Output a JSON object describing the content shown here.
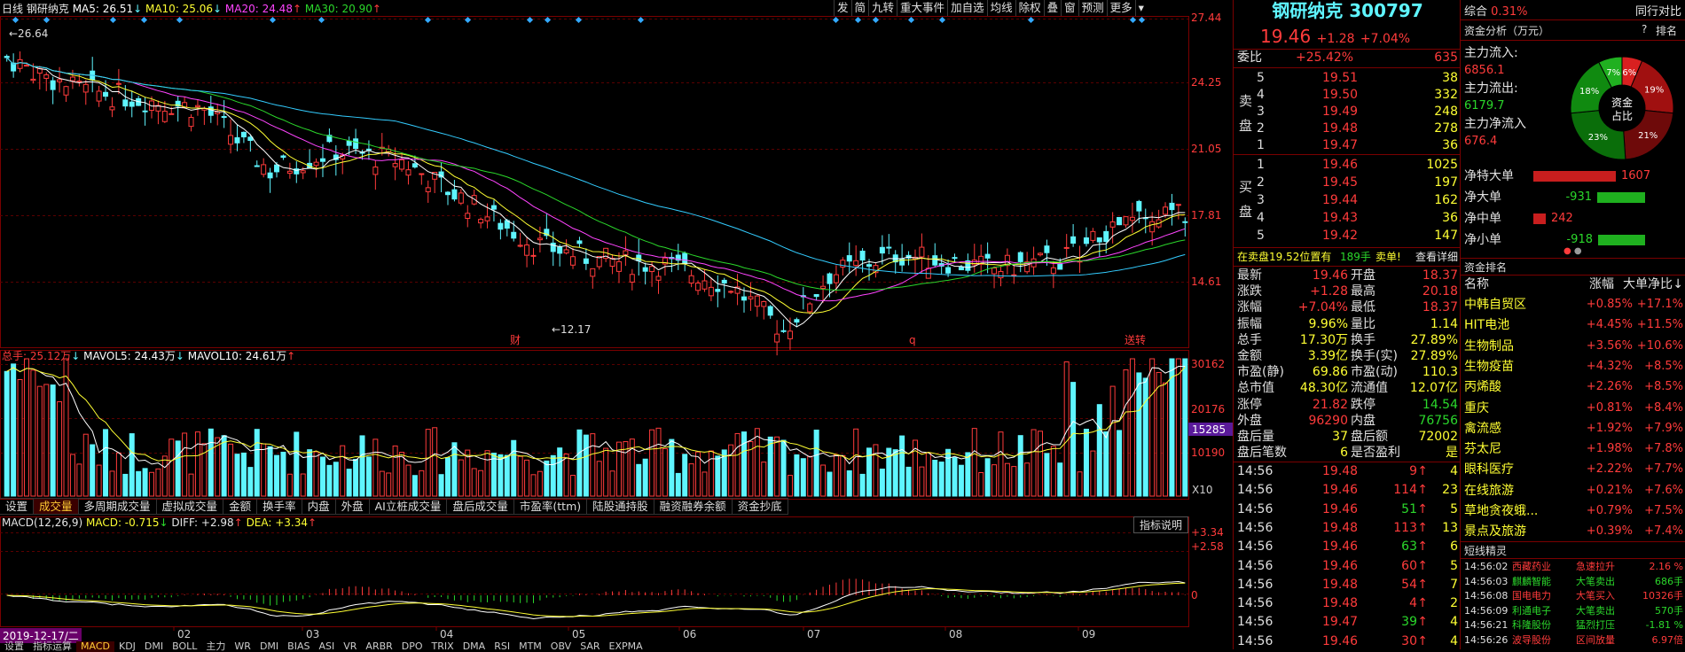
{
  "chart": {
    "period": "日线",
    "stock": "钢研纳克",
    "ma": [
      {
        "label": "MA5: 26.51",
        "color": "#ffffff",
        "dir": "down"
      },
      {
        "label": "MA10: 25.06",
        "color": "#ffff33",
        "dir": "down"
      },
      {
        "label": "MA20: 24.48",
        "color": "#ff44ff",
        "dir": "up"
      },
      {
        "label": "MA30: 20.90",
        "color": "#2bd82b",
        "dir": "up"
      }
    ],
    "toolbar": [
      "发",
      "简",
      "九转",
      "重大事件",
      "加自选",
      "均线",
      "除权",
      "叠",
      "窗",
      "预测",
      "更多"
    ],
    "price_ticks": [
      "27.44",
      "24.25",
      "21.05",
      "17.81",
      "14.61"
    ],
    "high_mark": "26.64",
    "low_mark": "12.17",
    "markers": [
      "财",
      "q",
      "送转"
    ],
    "vol_legend": [
      {
        "label": "总手: 25.12万",
        "color": "#ff3b3b",
        "dir": "down"
      },
      {
        "label": "MAVOL5: 24.43万",
        "color": "#ffffff",
        "dir": "down"
      },
      {
        "label": "MAVOL10: 24.61万",
        "color": "#ffffff",
        "dir": "up"
      }
    ],
    "vol_ticks": [
      "30162",
      "20176",
      "10190"
    ],
    "vol_flag": "15285",
    "vol_unit": "X10",
    "tabs": [
      "设置",
      "成交量",
      "多周期成交量",
      "虚拟成交量",
      "金额",
      "换手率",
      "内盘",
      "外盘",
      "AI立桩成交量",
      "盘后成交量",
      "市盈率(ttm)",
      "陆股通持股",
      "融资融券余额",
      "资金抄底"
    ],
    "tabs_active": 1,
    "macd_label": "MACD(12,26,9)",
    "macd_val": "MACD: -0.715",
    "diff_val": "DIFF: +2.98",
    "dea_val": "DEA: +3.34",
    "macd_ticks": [
      "+3.34",
      "+2.58",
      "0"
    ],
    "indicator_btn": "指标说明",
    "date_cursor": "2019-12-17/二",
    "months": [
      "02",
      "03",
      "04",
      "05",
      "06",
      "07",
      "08",
      "09"
    ],
    "bottom_tabs": [
      "设置",
      "指标运算",
      "MACD",
      "KDJ",
      "DMI",
      "BOLL",
      "主力",
      "WR",
      "DMI",
      "BIAS",
      "ASI",
      "VR",
      "ARBR",
      "DPO",
      "TRIX",
      "DMA",
      "RSI",
      "MTM",
      "OBV",
      "SAR",
      "EXPMA"
    ],
    "bottom_active": 2
  },
  "quote": {
    "name": "钢研纳克",
    "code": "300797",
    "price": "19.46",
    "change": "+1.28",
    "pct": "+7.04%",
    "weibi_label": "委比",
    "weibi": "+25.42%",
    "weibi_diff": "635",
    "sell_label": "卖盘",
    "buy_label": "买盘",
    "sell": [
      {
        "lv": "5",
        "p": "19.51",
        "v": "38"
      },
      {
        "lv": "4",
        "p": "19.50",
        "v": "332"
      },
      {
        "lv": "3",
        "p": "19.49",
        "v": "248"
      },
      {
        "lv": "2",
        "p": "19.48",
        "v": "278"
      },
      {
        "lv": "1",
        "p": "19.47",
        "v": "36"
      }
    ],
    "buy": [
      {
        "lv": "1",
        "p": "19.46",
        "v": "1025"
      },
      {
        "lv": "2",
        "p": "19.45",
        "v": "197"
      },
      {
        "lv": "3",
        "p": "19.44",
        "v": "162"
      },
      {
        "lv": "4",
        "p": "19.43",
        "v": "36"
      },
      {
        "lv": "5",
        "p": "19.42",
        "v": "147"
      }
    ],
    "notice": "在卖盘19.52位置有",
    "notice_vol": "189手",
    "notice_act": "卖单!",
    "notice_link": "查看详细",
    "stats": [
      [
        "最新",
        "19.46",
        "开盘",
        "18.37"
      ],
      [
        "涨跌",
        "+1.28",
        "最高",
        "20.18"
      ],
      [
        "涨幅",
        "+7.04%",
        "最低",
        "18.37"
      ],
      [
        "振幅",
        "9.96%",
        "量比",
        "1.14"
      ],
      [
        "总手",
        "17.30万",
        "换手",
        "27.89%"
      ],
      [
        "金额",
        "3.39亿",
        "换手(实)",
        "27.89%"
      ],
      [
        "市盈(静)",
        "69.86",
        "市盈(动)",
        "110.3"
      ],
      [
        "总市值",
        "48.30亿",
        "流通值",
        "12.07亿"
      ],
      [
        "涨停",
        "21.82",
        "跌停",
        "14.54"
      ],
      [
        "外盘",
        "96290",
        "内盘",
        "76756"
      ],
      [
        "盘后量",
        "37",
        "盘后额",
        "72002"
      ],
      [
        "盘后笔数",
        "6",
        "是否盈利",
        "是"
      ]
    ],
    "ticks": [
      [
        "14:56",
        "19.48",
        "9",
        "4"
      ],
      [
        "14:56",
        "19.46",
        "114",
        "23"
      ],
      [
        "14:56",
        "19.46",
        "51",
        "5"
      ],
      [
        "14:56",
        "19.48",
        "113",
        "13"
      ],
      [
        "14:56",
        "19.46",
        "63",
        "6"
      ],
      [
        "14:56",
        "19.46",
        "60",
        "5"
      ],
      [
        "14:56",
        "19.48",
        "54",
        "7"
      ],
      [
        "14:56",
        "19.48",
        "4",
        "2"
      ],
      [
        "14:56",
        "19.47",
        "39",
        "4"
      ],
      [
        "14:56",
        "19.46",
        "30",
        "4"
      ]
    ]
  },
  "right": {
    "index_name": "综合",
    "index_pct": "0.31%",
    "peer": "同行对比",
    "flow_title": "资金分析（万元）",
    "flow_help": "?",
    "flow_rank": "排名",
    "inflow_label": "主力流入:",
    "inflow": "6856.1",
    "outflow_label": "主力流出:",
    "outflow": "6179.7",
    "net_label": "主力净流入",
    "net": "676.4",
    "donut_center": [
      "资金",
      "占比"
    ],
    "donut": [
      {
        "pct": "6%",
        "color": "#d82020"
      },
      {
        "pct": "19%",
        "color": "#a01010"
      },
      {
        "pct": "21%",
        "color": "#6e0a0a"
      },
      {
        "pct": "23%",
        "color": "#0a6e0a"
      },
      {
        "pct": "18%",
        "color": "#108a10"
      },
      {
        "pct": "7%",
        "color": "#20b020"
      }
    ],
    "net_rows": [
      {
        "label": "净特大单",
        "val": "1607",
        "sign": 1,
        "frac": 0.58
      },
      {
        "label": "净大单",
        "val": "-931",
        "sign": -1,
        "frac": 0.34
      },
      {
        "label": "净中单",
        "val": "242",
        "sign": 1,
        "frac": 0.09
      },
      {
        "label": "净小单",
        "val": "-918",
        "sign": -1,
        "frac": 0.33
      }
    ],
    "rank_title": "资金排名",
    "rank_cols": [
      "名称",
      "涨幅",
      "大单净比"
    ],
    "rank": [
      [
        "中韩自贸区",
        "+0.85%",
        "+17.1%"
      ],
      [
        "HIT电池",
        "+4.45%",
        "+11.5%"
      ],
      [
        "生物制品",
        "+3.56%",
        "+10.6%"
      ],
      [
        "生物疫苗",
        "+4.32%",
        "+8.5%"
      ],
      [
        "丙烯酸",
        "+2.26%",
        "+8.5%"
      ],
      [
        "重庆",
        "+0.81%",
        "+8.4%"
      ],
      [
        "禽流感",
        "+1.92%",
        "+7.9%"
      ],
      [
        "芬太尼",
        "+1.98%",
        "+7.8%"
      ],
      [
        "眼科医疗",
        "+2.22%",
        "+7.7%"
      ],
      [
        "在线旅游",
        "+0.21%",
        "+7.6%"
      ],
      [
        "草地贪夜蛾...",
        "+0.79%",
        "+7.5%"
      ],
      [
        "景点及旅游",
        "+0.39%",
        "+7.4%"
      ]
    ],
    "sprite_title": "短线精灵",
    "sprites": [
      [
        "14:56:02",
        "西藏药业",
        "急速拉升",
        "2.16 %",
        "#ff3b3b"
      ],
      [
        "14:56:03",
        "麒麟智能",
        "大笔卖出",
        "686手",
        "#2bd82b"
      ],
      [
        "14:56:08",
        "国电电力",
        "大笔买入",
        "10326手",
        "#ff3b3b"
      ],
      [
        "14:56:09",
        "利通电子",
        "大笔卖出",
        "570手",
        "#2bd82b"
      ],
      [
        "14:56:21",
        "科隆股份",
        "猛烈打压",
        "-1.81 %",
        "#2bd82b"
      ],
      [
        "14:56:26",
        "波导股份",
        "区间放量",
        "6.97倍",
        "#ff3b3b"
      ]
    ]
  }
}
